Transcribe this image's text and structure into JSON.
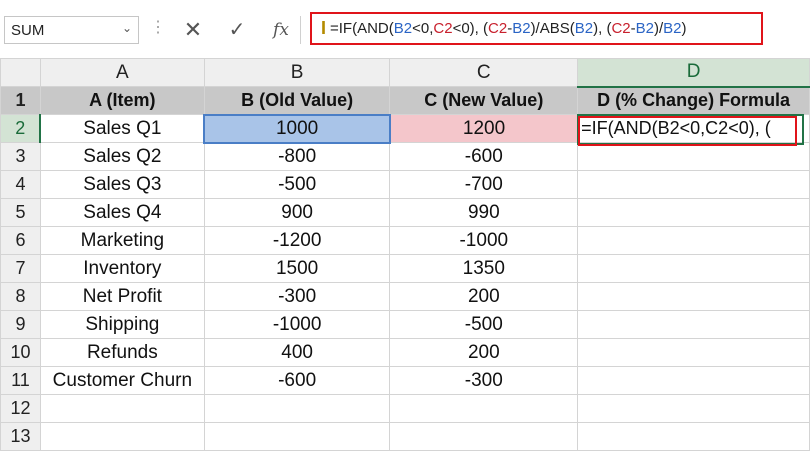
{
  "name_box": {
    "value": "SUM",
    "arrow": "⌄"
  },
  "separator": "⋮",
  "buttons": {
    "cancel": "✕",
    "enter": "✓",
    "fx": "fx"
  },
  "formula_parts": [
    {
      "t": "=IF(AND(",
      "c": "dark"
    },
    {
      "t": "B2",
      "c": "blue"
    },
    {
      "t": "<0,",
      "c": "dark"
    },
    {
      "t": "C2",
      "c": "red"
    },
    {
      "t": "<0), (",
      "c": "dark"
    },
    {
      "t": "C2",
      "c": "red"
    },
    {
      "t": "-",
      "c": "dark"
    },
    {
      "t": "B2",
      "c": "blue"
    },
    {
      "t": ")/ABS(",
      "c": "dark"
    },
    {
      "t": "B2",
      "c": "blue"
    },
    {
      "t": "), (",
      "c": "dark"
    },
    {
      "t": "C2",
      "c": "red"
    },
    {
      "t": "-",
      "c": "dark"
    },
    {
      "t": "B2",
      "c": "blue"
    },
    {
      "t": ")/",
      "c": "dark"
    },
    {
      "t": "B2",
      "c": "blue"
    },
    {
      "t": ")",
      "c": "dark"
    }
  ],
  "column_letters": [
    "A",
    "B",
    "C",
    "D"
  ],
  "header_row": [
    "A (Item)",
    "B (Old Value)",
    "C (New Value)",
    "D (% Change) Formula"
  ],
  "rows": [
    [
      "Sales Q1",
      "1000",
      "1200",
      "=IF(AND(B2<0,C2<0), ("
    ],
    [
      "Sales Q2",
      "-800",
      "-600",
      ""
    ],
    [
      "Sales Q3",
      "-500",
      "-700",
      ""
    ],
    [
      "Sales Q4",
      "900",
      "990",
      ""
    ],
    [
      "Marketing",
      "-1200",
      "-1000",
      ""
    ],
    [
      "Inventory",
      "1500",
      "1350",
      ""
    ],
    [
      "Net Profit",
      "-300",
      "200",
      ""
    ],
    [
      "Shipping",
      "-1000",
      "-500",
      ""
    ],
    [
      "Refunds",
      "400",
      "200",
      ""
    ],
    [
      "Customer Churn",
      "-600",
      "-300",
      ""
    ],
    [
      "",
      "",
      "",
      ""
    ],
    [
      "",
      "",
      "",
      ""
    ]
  ],
  "row_numbers": [
    "1",
    "2",
    "3",
    "4",
    "5",
    "6",
    "7",
    "8",
    "9",
    "10",
    "11",
    "12",
    "13"
  ],
  "colors": {
    "selection_green": "#217346",
    "highlight_red": "#e0141a",
    "b2_fill": "#a9c4e8",
    "c2_fill": "#f4c6cb"
  }
}
